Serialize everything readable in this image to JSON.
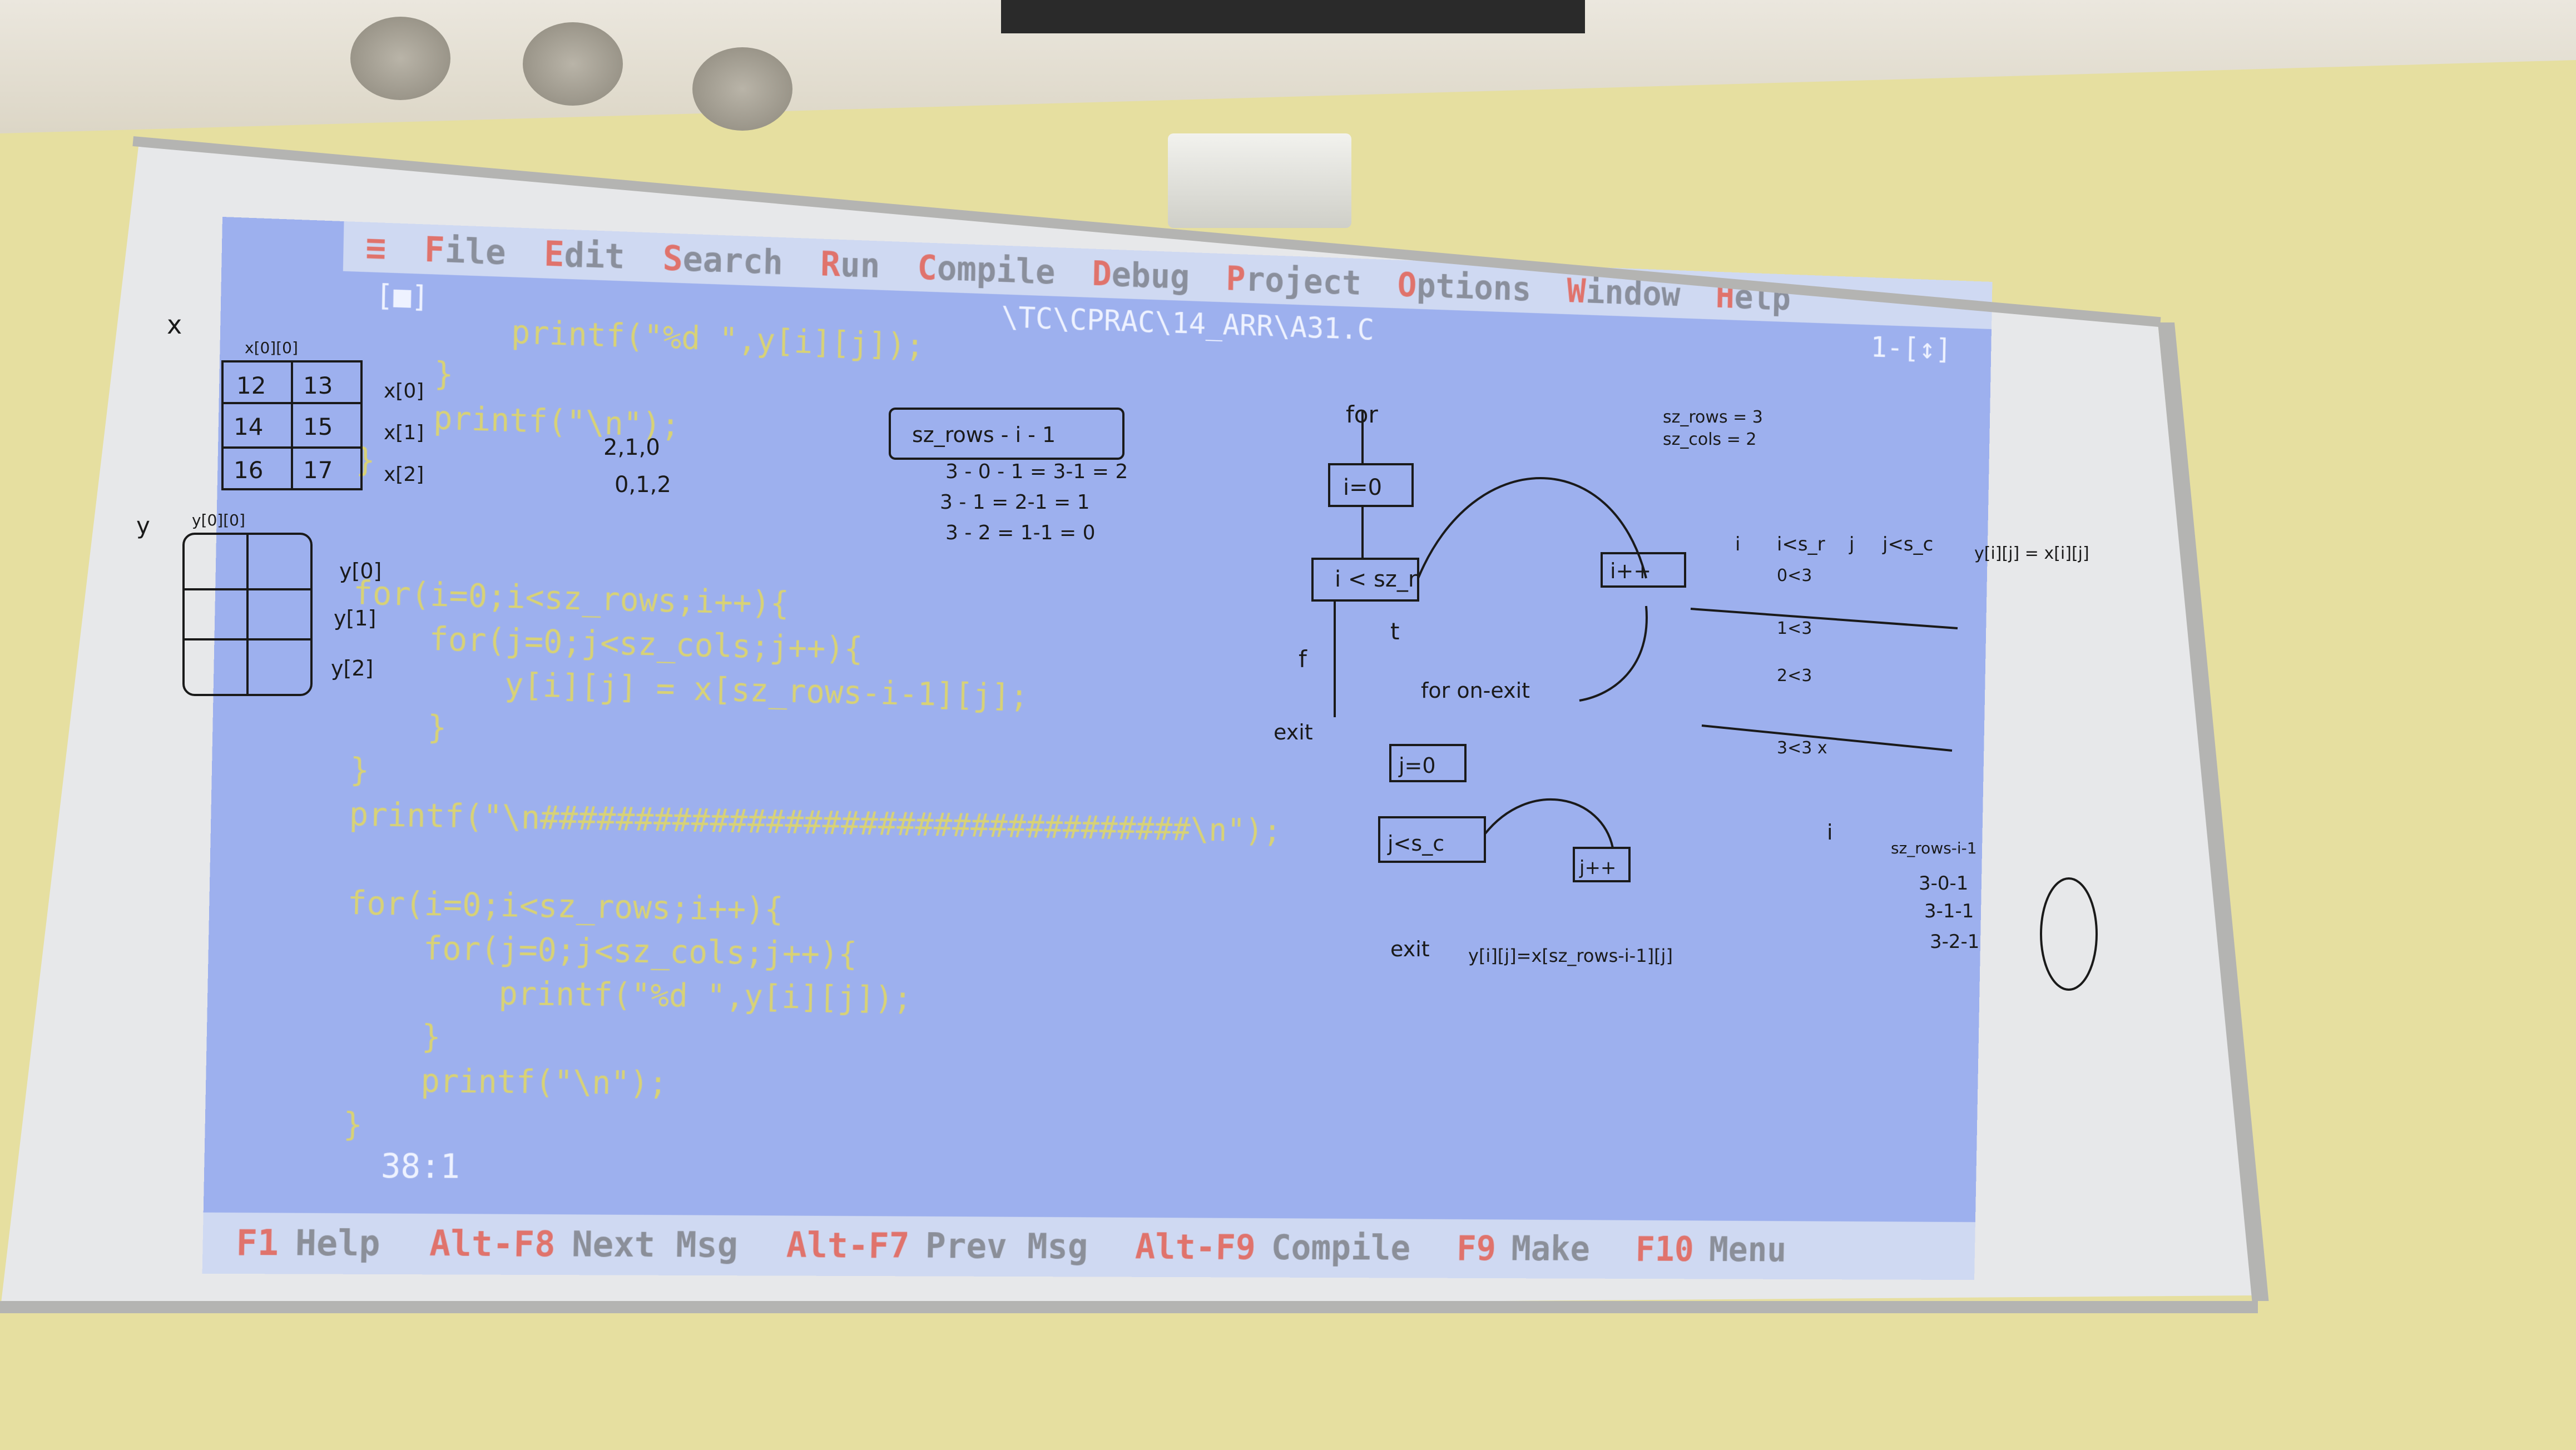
{
  "menu": {
    "items": [
      "≡",
      "File",
      "Edit",
      "Search",
      "Run",
      "Compile",
      "Debug",
      "Project",
      "Options",
      "Window",
      "Help"
    ]
  },
  "editor": {
    "window_control": "[■]",
    "file_path": "\\TC\\CPRAC\\14_ARR\\A31.C",
    "window_number": "1-[↕]",
    "cursor_position": "38:1",
    "code_lines": [
      "        printf(\"%d \",y[i][j]);",
      "    }",
      "    printf(\"\\n\");",
      "}",
      "",
      "",
      "for(i=0;i<sz_rows;i++){",
      "    for(j=0;j<sz_cols;j++){",
      "        y[i][j] = x[sz_rows-i-1][j];",
      "    }",
      "}",
      "printf(\"\\n###################################\\n\");",
      "",
      "for(i=0;i<sz_rows;i++){",
      "    for(j=0;j<sz_cols;j++){",
      "        printf(\"%d \",y[i][j]);",
      "    }",
      "    printf(\"\\n\");",
      "}"
    ]
  },
  "hints": [
    {
      "key": "F1",
      "label": "Help"
    },
    {
      "key": "Alt-F8",
      "label": "Next Msg"
    },
    {
      "key": "Alt-F7",
      "label": "Prev Msg"
    },
    {
      "key": "Alt-F9",
      "label": "Compile"
    },
    {
      "key": "F9",
      "label": "Make"
    },
    {
      "key": "F10",
      "label": "Menu"
    }
  ],
  "handwriting": {
    "left": [
      "x",
      "x[0][0]",
      "12",
      "13",
      "14",
      "15",
      "16",
      "17",
      "x[0]",
      "x[1]",
      "x[2]",
      "y",
      "y[0][0]",
      "y[0]",
      "y[1]",
      "y[2]"
    ],
    "middle": [
      "2,1,0",
      "0,1,2",
      "sz_rows - i - 1",
      "3 - 0 - 1 = 3-1 = 2",
      "3 - 1 = 2-1 = 1",
      "3 - 2 = 1-1 = 0"
    ],
    "flow": [
      "for",
      "i=0",
      "i < sz_r",
      "i++",
      "f",
      "t",
      "exit",
      "for on-exit",
      "j=0",
      "j<s_c",
      "j++",
      "y[i][j]=x[sz_rows-i-1][j]"
    ],
    "right": [
      "sz_rows = 3",
      "sz_cols = 2",
      "i",
      "i<s_r",
      "j",
      "j<s_c",
      "0<3",
      "1<3",
      "2<3",
      "3<3 x",
      "y[i][j] = x[i][j]",
      "i",
      "sz_rows-i-1",
      "3-0-1",
      "3-1-1",
      "3-2-1"
    ]
  },
  "colors": {
    "screen": "#9db0ee",
    "code": "#d8d276",
    "hotkey": "#e0736c"
  }
}
